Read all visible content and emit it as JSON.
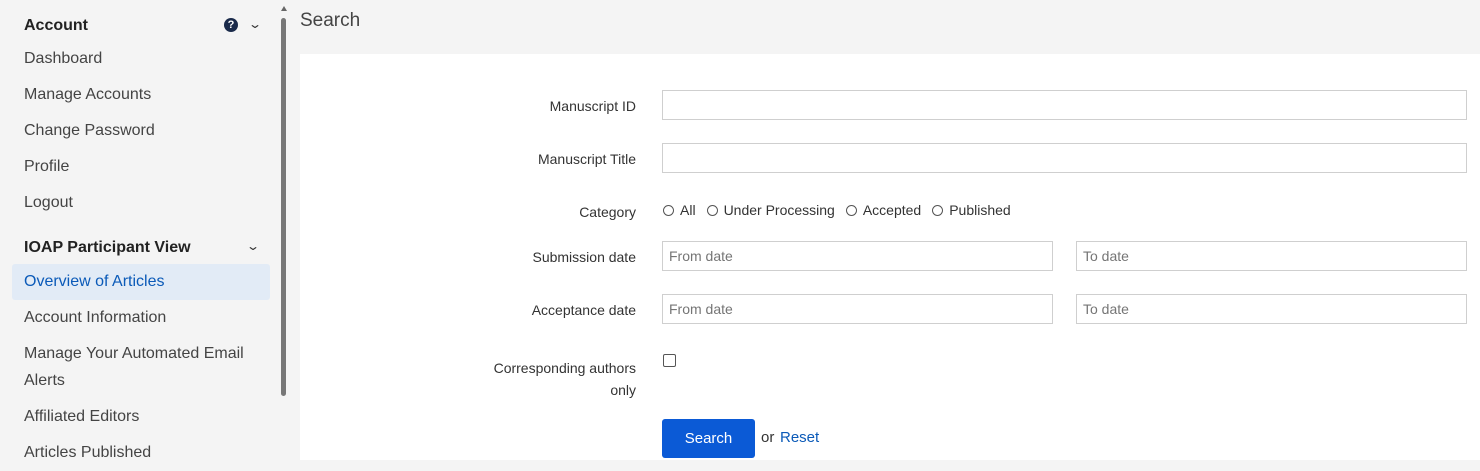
{
  "sidebar": {
    "sections": [
      {
        "title": "Account",
        "items": [
          "Dashboard",
          "Manage Accounts",
          "Change Password",
          "Profile",
          "Logout"
        ]
      },
      {
        "title": "IOAP Participant View",
        "items": [
          "Overview of Articles",
          "Account Information",
          "Manage Your Automated Email",
          "Alerts",
          "Affiliated Editors",
          "Articles Published"
        ],
        "active_item": "Overview of Articles"
      }
    ],
    "help_glyph": "?"
  },
  "main": {
    "title": "Search",
    "form": {
      "manuscript_id_label": "Manuscript ID",
      "manuscript_id_value": "",
      "manuscript_title_label": "Manuscript Title",
      "manuscript_title_value": "",
      "category_label": "Category",
      "category_options": [
        "All",
        "Under Processing",
        "Accepted",
        "Published"
      ],
      "submission_date_label": "Submission date",
      "acceptance_date_label": "Acceptance date",
      "from_placeholder": "From date",
      "to_placeholder": "To date",
      "corresponding_label_line1": "Corresponding authors",
      "corresponding_label_line2": "only",
      "corresponding_checked": false,
      "search_button": "Search",
      "or_text": "or",
      "reset_link": "Reset"
    }
  },
  "colors": {
    "accent": "#0b5ad6",
    "link": "#0b5ab8",
    "active_bg": "#e2ebf6",
    "page_bg": "#f4f4f4"
  }
}
